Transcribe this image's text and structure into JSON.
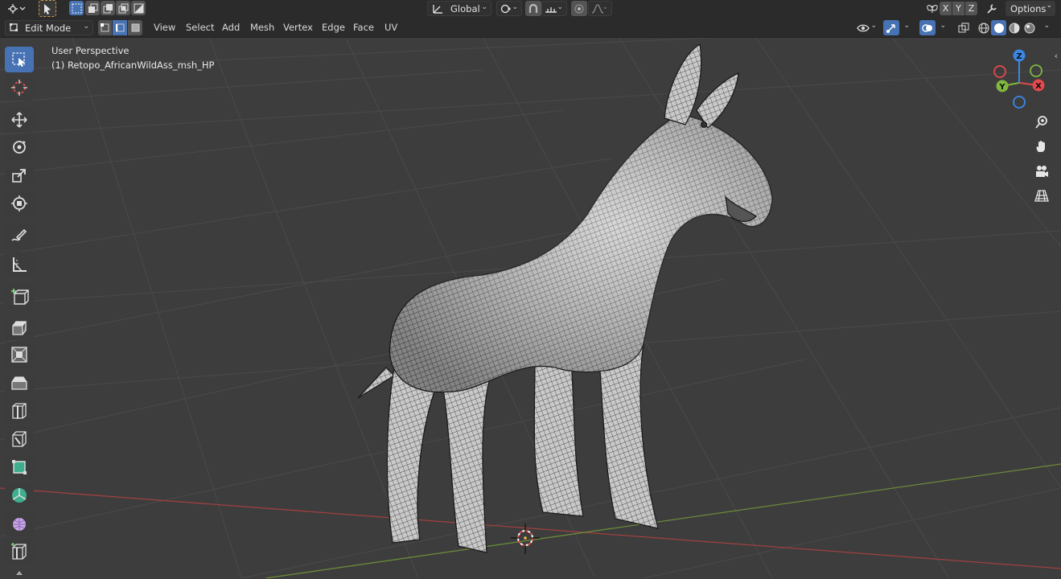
{
  "topbar": {
    "transform_orientation": "Global",
    "axis_x": "X",
    "axis_y": "Y",
    "axis_z": "Z",
    "options_label": "Options"
  },
  "header": {
    "mode": "Edit Mode",
    "menus": [
      "View",
      "Select",
      "Add",
      "Mesh",
      "Vertex",
      "Edge",
      "Face",
      "UV"
    ]
  },
  "viewport": {
    "view_name": "User Perspective",
    "object_name": "(1) Retopo_AfricanWildAss_msh_HP"
  },
  "gizmo": {
    "x_label": "X",
    "y_label": "Y",
    "z_label": "Z",
    "x_color": "#e5484d",
    "y_color": "#7fb73f",
    "z_color": "#3a88e6"
  },
  "colors": {
    "active": "#4772b3",
    "panel": "#2b2b2b",
    "viewport": "#3d3d3d",
    "grid": "#4a4a4a",
    "x_axis_line": "#a0403f",
    "y_axis_line": "#6a8a3a"
  },
  "toolbar_icons": [
    "select-box-icon",
    "cursor-icon",
    "move-icon",
    "rotate-icon",
    "scale-icon",
    "transform-icon",
    "annotate-icon",
    "measure-icon",
    "add-cube-icon",
    "extrude-icon",
    "inset-icon",
    "bevel-icon",
    "loop-cut-icon",
    "knife-icon",
    "poly-build-icon",
    "spin-icon",
    "smooth-icon",
    "edge-slide-icon"
  ]
}
